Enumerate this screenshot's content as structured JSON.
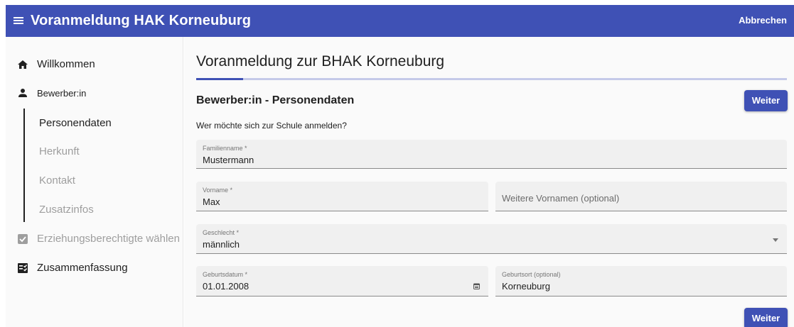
{
  "appbar": {
    "title": "Voranmeldung HAK Korneuburg",
    "cancel_label": "Abbrechen",
    "menu_icon": "hamburger-menu-icon"
  },
  "sidebar": {
    "items": [
      {
        "label": "Willkommen",
        "icon": "home-icon"
      },
      {
        "label": "Bewerber:in",
        "icon": "person-icon"
      },
      {
        "label": "Erziehungsberechtigte wählen",
        "icon": "checkbox-icon"
      },
      {
        "label": "Zusammenfassung",
        "icon": "checklist-icon"
      }
    ],
    "subitems": [
      {
        "label": "Personendaten",
        "active": true
      },
      {
        "label": "Herkunft",
        "active": false
      },
      {
        "label": "Kontakt",
        "active": false
      },
      {
        "label": "Zusatzinfos",
        "active": false
      }
    ]
  },
  "main": {
    "page_title": "Voranmeldung zur BHAK Korneuburg",
    "progress": 0.08,
    "section_title": "Bewerber:in - Personendaten",
    "weiter_label": "Weiter",
    "question": "Wer möchte sich zur Schule anmelden?",
    "fields": {
      "familienname": {
        "label": "Familienname *",
        "value": "Mustermann"
      },
      "vorname": {
        "label": "Vorname *",
        "value": "Max"
      },
      "weitere_vornamen": {
        "placeholder": "Weitere Vornamen (optional)"
      },
      "geschlecht": {
        "label": "Geschlecht *",
        "value": "männlich"
      },
      "geburtsdatum": {
        "label": "Geburtsdatum *",
        "value": "01.01.2008"
      },
      "geburtsort": {
        "label": "Geburtsort (optional)",
        "value": "Korneuburg"
      }
    }
  },
  "colors": {
    "primary": "#3f51b5",
    "progress_track": "#c5cae9",
    "disabled_text": "#9e9e9e"
  }
}
